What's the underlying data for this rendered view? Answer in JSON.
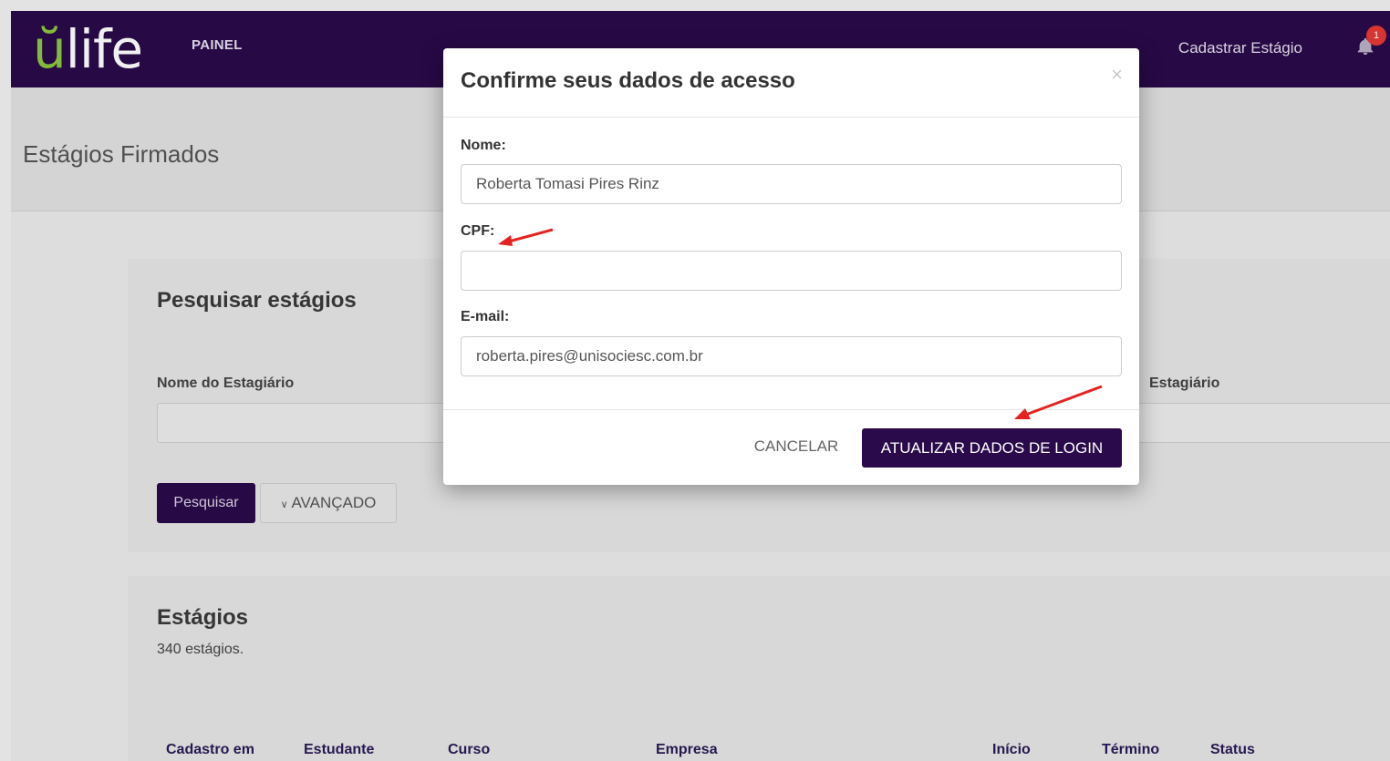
{
  "navbar": {
    "logo": "ulife",
    "logo_first": "ŭ",
    "logo_rest": "life",
    "painel": "PAINEL",
    "cadastrar": "Cadastrar Estágio",
    "notification_count": "1"
  },
  "page": {
    "title": "Estágios Firmados"
  },
  "search": {
    "heading": "Pesquisar estágios",
    "name_label": "Nome do Estagiário",
    "right_label": "Estagiário",
    "pesquisar": "Pesquisar",
    "avancado": "AVANÇADO"
  },
  "list": {
    "heading": "Estágios",
    "count": "340 estágios.",
    "columns": [
      "Cadastro em",
      "Estudante",
      "Curso",
      "Empresa",
      "Início",
      "Término",
      "Status"
    ]
  },
  "modal": {
    "title": "Confirme seus dados de acesso",
    "close": "×",
    "nome_label": "Nome:",
    "nome_value": "Roberta Tomasi Pires Rinz",
    "cpf_label": "CPF:",
    "cpf_value": "",
    "email_label": "E-mail:",
    "email_value": "roberta.pires@unisociesc.com.br",
    "cancel": "CANCELAR",
    "submit": "ATUALIZAR DADOS DE LOGIN"
  },
  "colors": {
    "brand": "#2a0a4a",
    "logo_accent": "#8dc63f",
    "arrow": "#e52222",
    "badge": "#e53935"
  }
}
